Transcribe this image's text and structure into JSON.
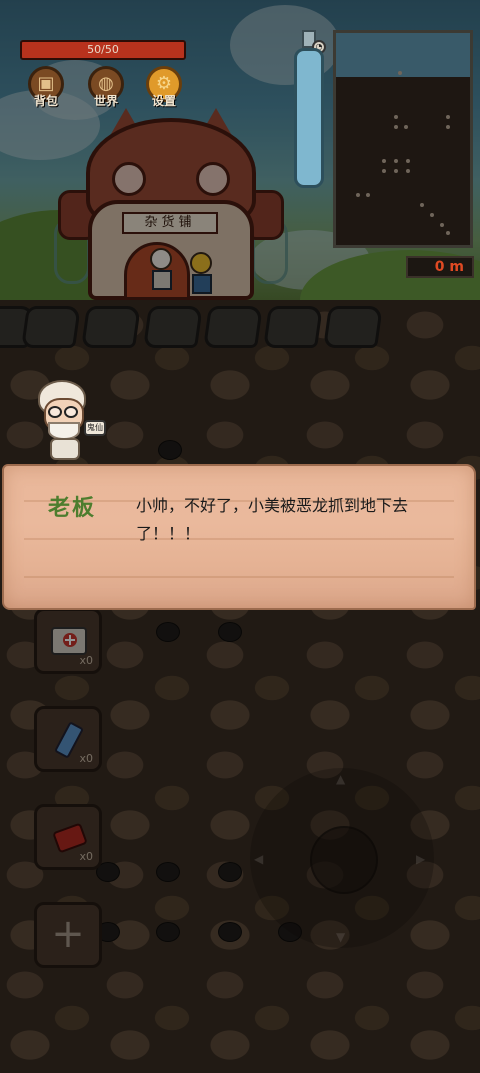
{
  "hud": {
    "hp_text": "50/50",
    "hp_fraction": 1.0,
    "depth_value": "0",
    "depth_unit": "m"
  },
  "menu": {
    "backpack_label": "背包",
    "world_label": "世界",
    "settings_label": "设置"
  },
  "shop": {
    "sign_text": "杂货铺"
  },
  "npc": {
    "tag_text": "鬼仙"
  },
  "dialog": {
    "speaker": "老板",
    "text": "小帅，不好了，小美被恶龙抓到地下去了！！！"
  },
  "inventory": {
    "medkit_count": "x0",
    "lighter_count": "x0",
    "dynamite_count": "x0"
  },
  "icons": {
    "backpack": "backpack-icon",
    "world": "globe-icon",
    "settings": "gear-icon",
    "oxygen": "oxygen-tank-icon",
    "medkit": "medkit-icon",
    "lighter": "lighter-icon",
    "dynamite": "dynamite-icon",
    "add": "plus-icon"
  },
  "colors": {
    "hp": "#b8321d",
    "depth_text": "#e04a23",
    "speaker_name": "#4d7d2e",
    "dialog_bg": "#e9b79a"
  }
}
